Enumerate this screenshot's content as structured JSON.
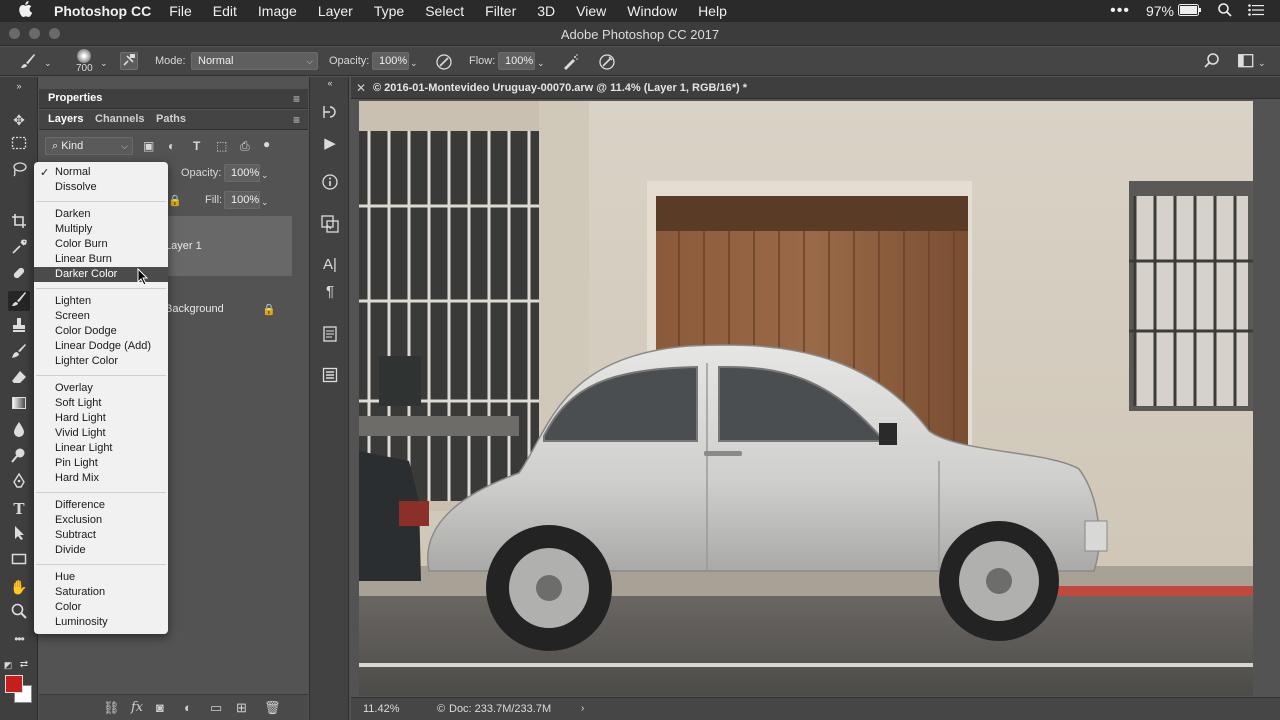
{
  "menubar": {
    "app_name": "Photoshop CC",
    "items": [
      "File",
      "Edit",
      "Image",
      "Layer",
      "Type",
      "Select",
      "Filter",
      "3D",
      "View",
      "Window",
      "Help"
    ],
    "battery": "97%",
    "icons": [
      "apple-icon",
      "more-icon",
      "battery-icon",
      "spotlight-search-icon",
      "notification-list-icon"
    ]
  },
  "window": {
    "title": "Adobe Photoshop CC 2017"
  },
  "options_bar": {
    "brush_size": "700",
    "mode_label": "Mode:",
    "mode_value": "Normal",
    "opacity_label": "Opacity:",
    "opacity_value": "100%",
    "flow_label": "Flow:",
    "flow_value": "100%"
  },
  "panels": {
    "properties_tab": "Properties",
    "tabs": [
      "Layers",
      "Channels",
      "Paths"
    ],
    "filter_kind": "Kind",
    "opacity_label": "Opacity:",
    "opacity_value": "100%",
    "fill_label": "Fill:",
    "fill_value": "100%",
    "layers": [
      {
        "name": "Layer 1",
        "selected": true
      },
      {
        "name": "Background",
        "locked": true
      }
    ]
  },
  "blend_menu": {
    "selected": "Normal",
    "highlighted": "Darker Color",
    "groups": [
      [
        "Normal",
        "Dissolve"
      ],
      [
        "Darken",
        "Multiply",
        "Color Burn",
        "Linear Burn",
        "Darker Color"
      ],
      [
        "Lighten",
        "Screen",
        "Color Dodge",
        "Linear Dodge (Add)",
        "Lighter Color"
      ],
      [
        "Overlay",
        "Soft Light",
        "Hard Light",
        "Vivid Light",
        "Linear Light",
        "Pin Light",
        "Hard Mix"
      ],
      [
        "Difference",
        "Exclusion",
        "Subtract",
        "Divide"
      ],
      [
        "Hue",
        "Saturation",
        "Color",
        "Luminosity"
      ]
    ]
  },
  "document": {
    "tab_title": "© 2016-01-Montevideo Uruguay-00070.arw @ 11.4% (Layer 1, RGB/16*) *",
    "zoom": "11.42%",
    "doc_size": "Doc: 233.7M/233.7M"
  },
  "colors": {
    "foreground": "#c41e1e",
    "background": "#ffffff"
  }
}
